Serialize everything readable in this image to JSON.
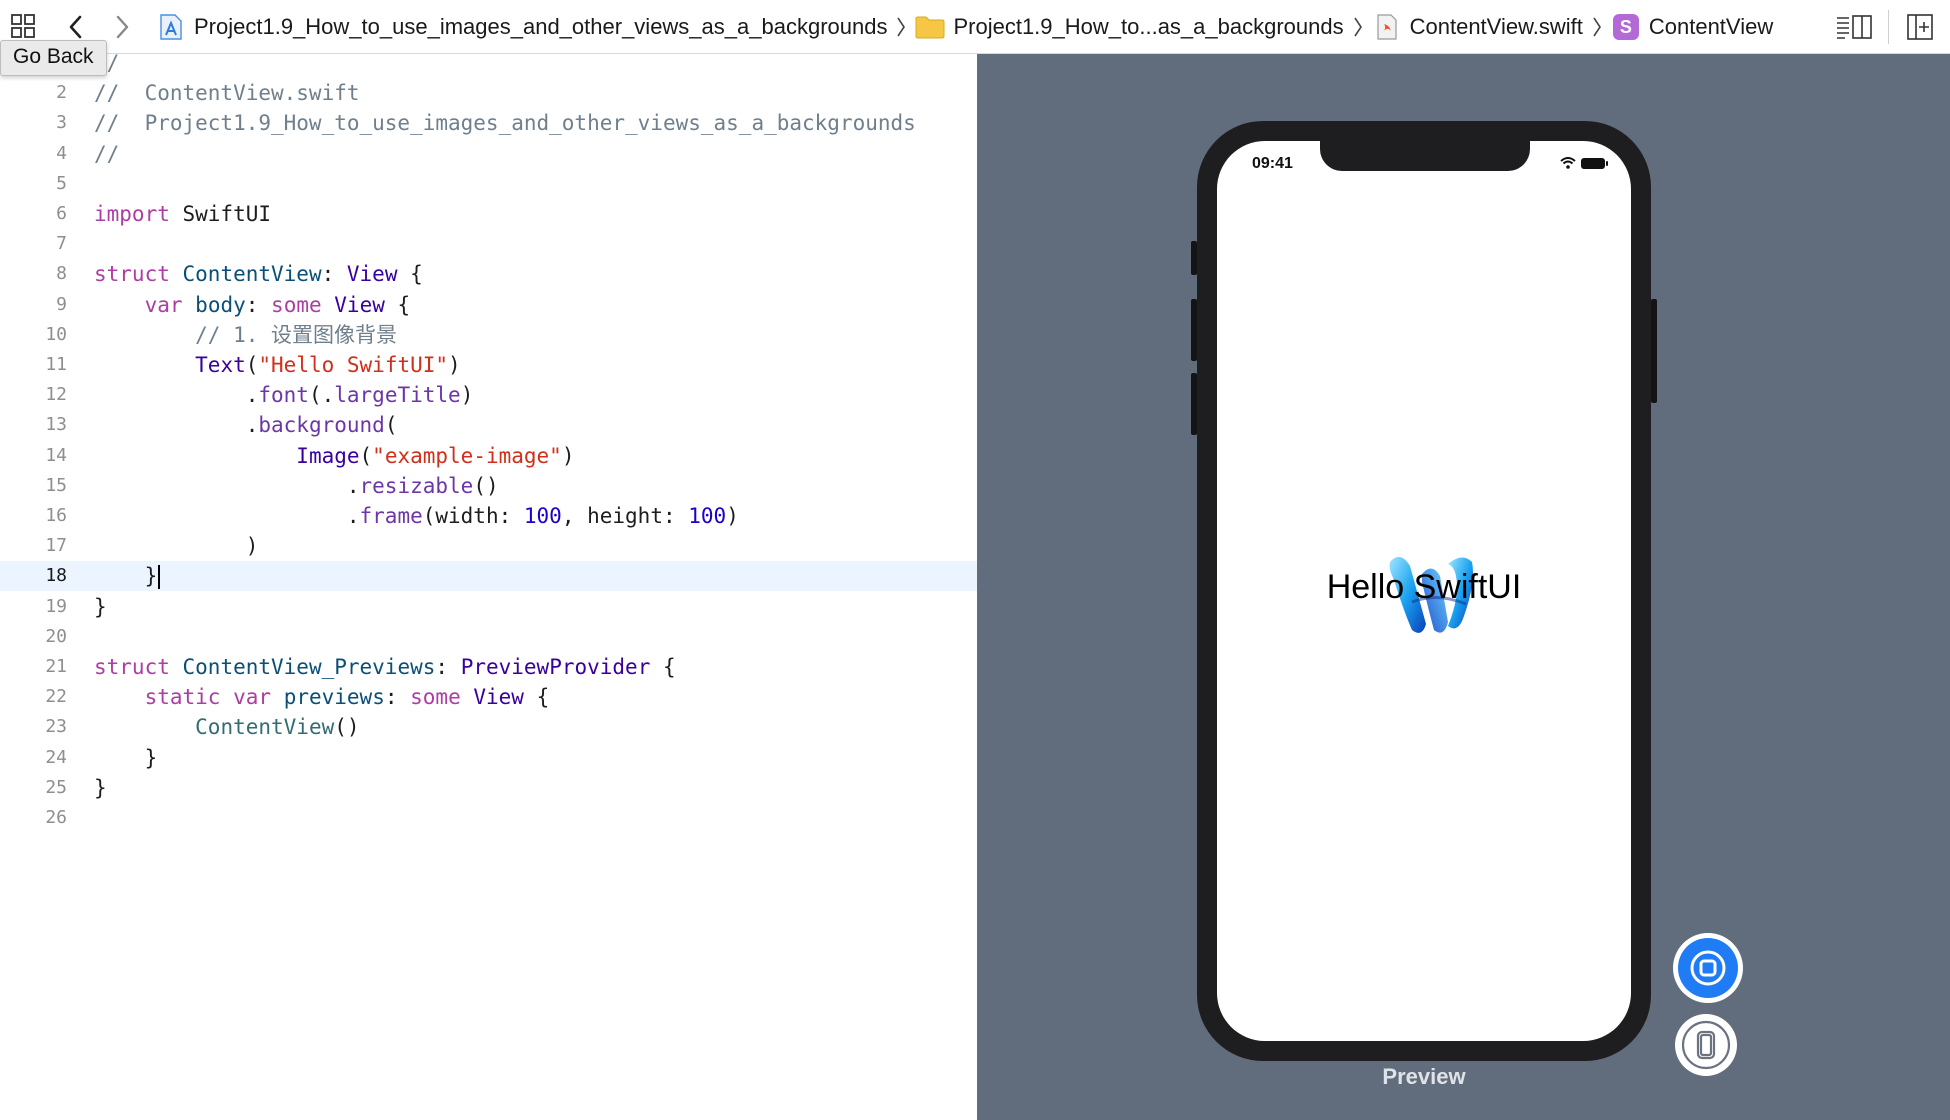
{
  "tooltip": {
    "text": "Go Back"
  },
  "jumpbar": {
    "crumbs": [
      {
        "label": "Project1.9_How_to_use_images_and_other_views_as_a_backgrounds",
        "icon": "xcode-project-icon"
      },
      {
        "label": "Project1.9_How_to...as_a_backgrounds",
        "icon": "folder-icon"
      },
      {
        "label": "ContentView.swift",
        "icon": "swift-file-icon"
      },
      {
        "label": "ContentView",
        "icon": "struct-symbol-icon",
        "badge": "S"
      }
    ]
  },
  "editor": {
    "current_line": 18,
    "line_numbers": [
      "1",
      "2",
      "3",
      "4",
      "5",
      "6",
      "7",
      "8",
      "9",
      "10",
      "11",
      "12",
      "13",
      "14",
      "15",
      "16",
      "17",
      "18",
      "19",
      "20",
      "21",
      "22",
      "23",
      "24",
      "25",
      "26"
    ],
    "lines": [
      [
        {
          "t": "//",
          "c": "cm"
        }
      ],
      [
        {
          "t": "//  ContentView.swift",
          "c": "cm"
        }
      ],
      [
        {
          "t": "//  Project1.9_How_to_use_images_and_other_views_as_a_backgrounds",
          "c": "cm"
        }
      ],
      [
        {
          "t": "//",
          "c": "cm"
        }
      ],
      [],
      [
        {
          "t": "import",
          "c": "kw"
        },
        {
          "t": " SwiftUI",
          "c": ""
        }
      ],
      [],
      [
        {
          "t": "struct",
          "c": "kw"
        },
        {
          "t": " ",
          "c": ""
        },
        {
          "t": "ContentView",
          "c": "ty"
        },
        {
          "t": ": ",
          "c": ""
        },
        {
          "t": "View",
          "c": "sy"
        },
        {
          "t": " {",
          "c": ""
        }
      ],
      [
        {
          "t": "    ",
          "c": ""
        },
        {
          "t": "var",
          "c": "kw"
        },
        {
          "t": " ",
          "c": ""
        },
        {
          "t": "body",
          "c": "ty"
        },
        {
          "t": ": ",
          "c": ""
        },
        {
          "t": "some",
          "c": "kw"
        },
        {
          "t": " ",
          "c": ""
        },
        {
          "t": "View",
          "c": "sy"
        },
        {
          "t": " {",
          "c": ""
        }
      ],
      [
        {
          "t": "        // 1. 设置图像背景",
          "c": "cm"
        }
      ],
      [
        {
          "t": "        ",
          "c": ""
        },
        {
          "t": "Text",
          "c": "sy"
        },
        {
          "t": "(",
          "c": ""
        },
        {
          "t": "\"Hello SwiftUI\"",
          "c": "st"
        },
        {
          "t": ")",
          "c": ""
        }
      ],
      [
        {
          "t": "            .",
          "c": ""
        },
        {
          "t": "font",
          "c": "fn"
        },
        {
          "t": "(.",
          "c": ""
        },
        {
          "t": "largeTitle",
          "c": "fn"
        },
        {
          "t": ")",
          "c": ""
        }
      ],
      [
        {
          "t": "            .",
          "c": ""
        },
        {
          "t": "background",
          "c": "fn"
        },
        {
          "t": "(",
          "c": ""
        }
      ],
      [
        {
          "t": "                ",
          "c": ""
        },
        {
          "t": "Image",
          "c": "sy"
        },
        {
          "t": "(",
          "c": ""
        },
        {
          "t": "\"example-image\"",
          "c": "st"
        },
        {
          "t": ")",
          "c": ""
        }
      ],
      [
        {
          "t": "                    .",
          "c": ""
        },
        {
          "t": "resizable",
          "c": "fn"
        },
        {
          "t": "()",
          "c": ""
        }
      ],
      [
        {
          "t": "                    .",
          "c": ""
        },
        {
          "t": "frame",
          "c": "fn"
        },
        {
          "t": "(width: ",
          "c": ""
        },
        {
          "t": "100",
          "c": "nu"
        },
        {
          "t": ", height: ",
          "c": ""
        },
        {
          "t": "100",
          "c": "nu"
        },
        {
          "t": ")",
          "c": ""
        }
      ],
      [
        {
          "t": "            )",
          "c": ""
        }
      ],
      [
        {
          "t": "    }",
          "c": ""
        }
      ],
      [
        {
          "t": "}",
          "c": ""
        }
      ],
      [],
      [
        {
          "t": "struct",
          "c": "kw"
        },
        {
          "t": " ",
          "c": ""
        },
        {
          "t": "ContentView_Previews",
          "c": "ty"
        },
        {
          "t": ": ",
          "c": ""
        },
        {
          "t": "PreviewProvider",
          "c": "sy"
        },
        {
          "t": " {",
          "c": ""
        }
      ],
      [
        {
          "t": "    ",
          "c": ""
        },
        {
          "t": "static",
          "c": "kw"
        },
        {
          "t": " ",
          "c": ""
        },
        {
          "t": "var",
          "c": "kw"
        },
        {
          "t": " ",
          "c": ""
        },
        {
          "t": "previews",
          "c": "ty"
        },
        {
          "t": ": ",
          "c": ""
        },
        {
          "t": "some",
          "c": "kw"
        },
        {
          "t": " ",
          "c": ""
        },
        {
          "t": "View",
          "c": "sy"
        },
        {
          "t": " {",
          "c": ""
        }
      ],
      [
        {
          "t": "        ",
          "c": ""
        },
        {
          "t": "ContentView",
          "c": "mb"
        },
        {
          "t": "()",
          "c": ""
        }
      ],
      [
        {
          "t": "    }",
          "c": ""
        }
      ],
      [
        {
          "t": "}",
          "c": ""
        }
      ],
      []
    ]
  },
  "preview": {
    "status_time": "09:41",
    "hello_text": "Hello SwiftUI",
    "label": "Preview"
  },
  "colors": {
    "canvas": "#616d7c",
    "accent": "#1f7cf4",
    "current_line": "#ecf5ff"
  }
}
